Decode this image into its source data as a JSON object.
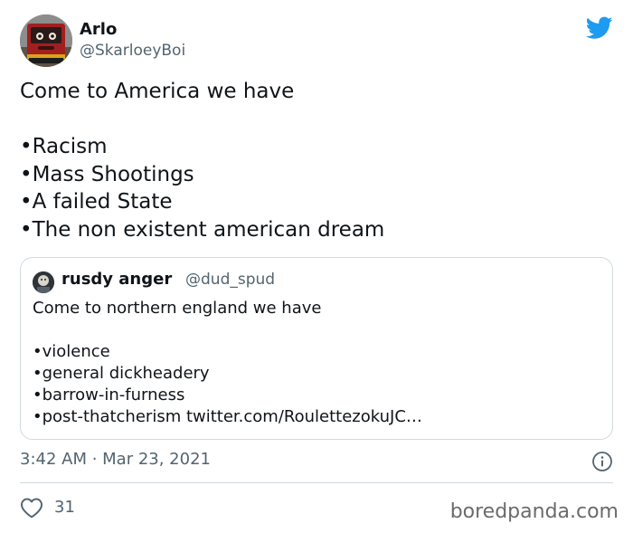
{
  "author": {
    "display_name": "Arlo",
    "handle": "@SkarloeyBoi",
    "avatar_icon": "red-train-engine-avatar"
  },
  "tweet": {
    "lines": [
      "Come to America we have",
      "",
      "•Racism",
      "•Mass Shootings",
      "•A failed State",
      "•The non existent american dream"
    ]
  },
  "quote": {
    "display_name": "rusdy anger",
    "handle": "@dud_spud",
    "lines": [
      "Come to northern england we have",
      "",
      "•violence",
      "•general dickheadery",
      "•barrow-in-furness",
      "•post-thatcherism twitter.com/RoulettezokuJC…"
    ]
  },
  "meta": {
    "timestamp": "3:42 AM · Mar 23, 2021"
  },
  "engagement": {
    "likes": "31"
  },
  "watermark": "boredpanda.com",
  "colors": {
    "twitter_blue": "#1d9bf0",
    "text_primary": "#0f1419",
    "text_secondary": "#536471",
    "border": "#cfd9de"
  },
  "icons": {
    "brand": "twitter-bird-icon",
    "info": "info-icon",
    "like": "heart-icon"
  }
}
